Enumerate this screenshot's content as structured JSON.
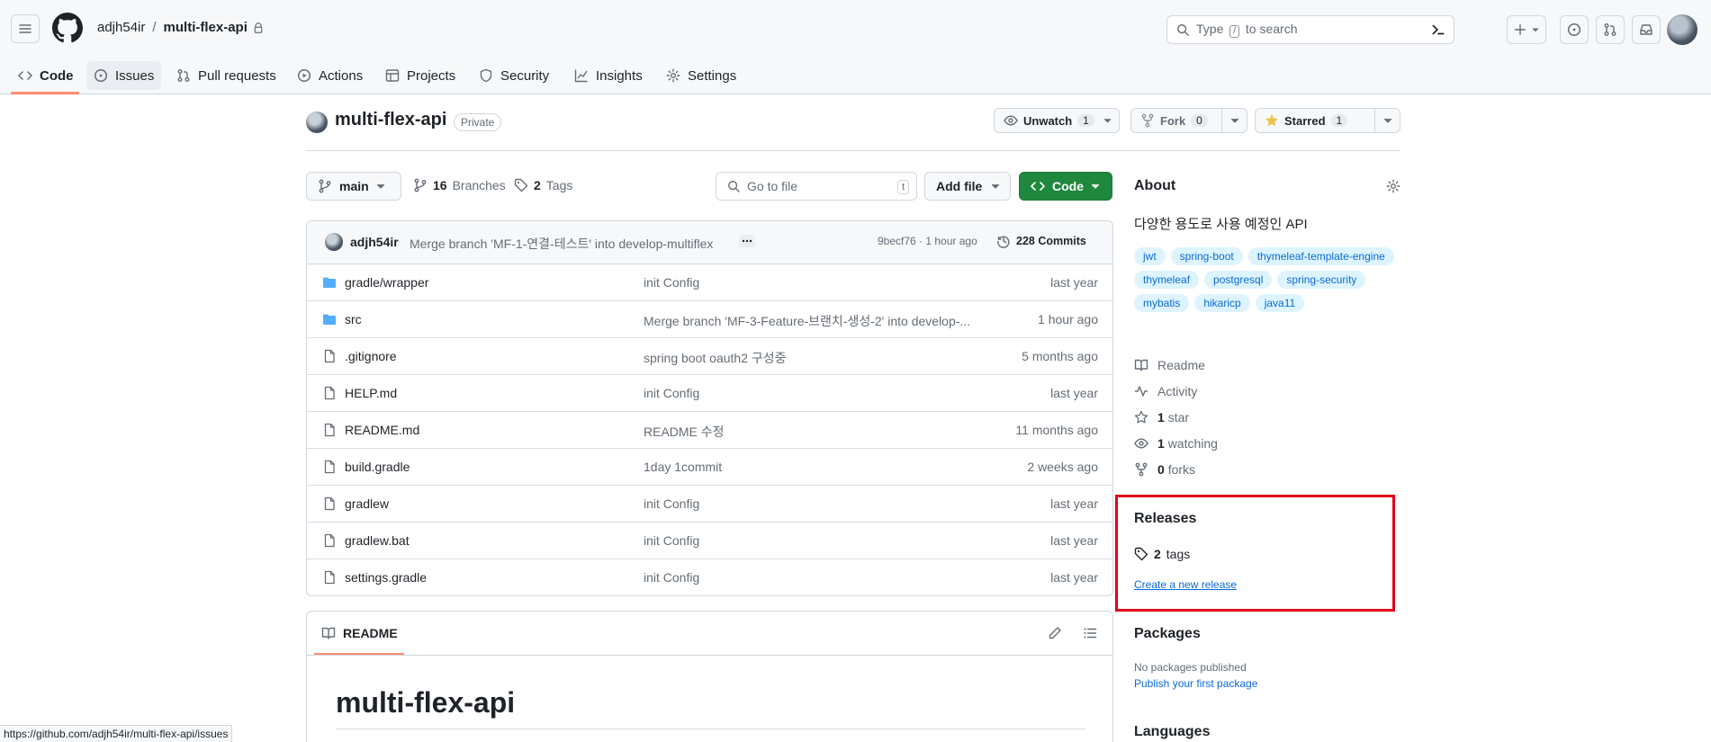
{
  "header": {
    "owner": "adjh54ir",
    "separator": "/",
    "repo": "multi-flex-api",
    "search_prefix": "Type",
    "search_key": "/",
    "search_suffix": "to search"
  },
  "tabs": [
    {
      "label": "Code"
    },
    {
      "label": "Issues"
    },
    {
      "label": "Pull requests"
    },
    {
      "label": "Actions"
    },
    {
      "label": "Projects"
    },
    {
      "label": "Security"
    },
    {
      "label": "Insights"
    },
    {
      "label": "Settings"
    }
  ],
  "repo": {
    "name": "multi-flex-api",
    "visibility": "Private",
    "watch_label": "Unwatch",
    "watch_count": "1",
    "fork_label": "Fork",
    "fork_count": "0",
    "star_label": "Starred",
    "star_count": "1"
  },
  "nav": {
    "branch": "main",
    "branches_count": "16",
    "branches_label": "Branches",
    "tags_count": "2",
    "tags_label": "Tags",
    "goto_placeholder": "Go to file",
    "goto_key": "t",
    "add_file": "Add file",
    "code": "Code"
  },
  "commit": {
    "author": "adjh54ir",
    "message": "Merge branch 'MF-1-연결-테스트' into develop-multiflex",
    "hash_time": "9becf76 · 1 hour ago",
    "count_label": "228 Commits"
  },
  "files": [
    {
      "name": "gradle/wrapper",
      "type": "dir",
      "message": "init Config",
      "time": "last year"
    },
    {
      "name": "src",
      "type": "dir",
      "message": "Merge branch 'MF-3-Feature-브랜치-생성-2' into develop-...",
      "time": "1 hour ago"
    },
    {
      "name": ".gitignore",
      "type": "file",
      "message": "spring boot oauth2 구성중",
      "time": "5 months ago"
    },
    {
      "name": "HELP.md",
      "type": "file",
      "message": "init Config",
      "time": "last year"
    },
    {
      "name": "README.md",
      "type": "file",
      "message": "README 수정",
      "time": "11 months ago"
    },
    {
      "name": "build.gradle",
      "type": "file",
      "message": "1day 1commit",
      "time": "2 weeks ago"
    },
    {
      "name": "gradlew",
      "type": "file",
      "message": "init Config",
      "time": "last year"
    },
    {
      "name": "gradlew.bat",
      "type": "file",
      "message": "init Config",
      "time": "last year"
    },
    {
      "name": "settings.gradle",
      "type": "file",
      "message": "init Config",
      "time": "last year"
    }
  ],
  "readme": {
    "tab_label": "README",
    "title": "multi-flex-api"
  },
  "about": {
    "title": "About",
    "description": "다양한 용도로 사용 예정인 API",
    "topics": [
      "jwt",
      "spring-boot",
      "thymeleaf-template-engine",
      "thymeleaf",
      "postgresql",
      "spring-security",
      "mybatis",
      "hikaricp",
      "java11"
    ],
    "readme": "Readme",
    "activity": "Activity",
    "stars_count": "1",
    "stars_label": "star",
    "watching_count": "1",
    "watching_label": "watching",
    "forks_count": "0",
    "forks_label": "forks"
  },
  "releases": {
    "title": "Releases",
    "tags_count": "2",
    "tags_label": "tags",
    "create_link": "Create a new release"
  },
  "packages": {
    "title": "Packages",
    "none": "No packages published",
    "publish_link": "Publish your first package"
  },
  "languages": {
    "title": "Languages"
  },
  "status_bar": {
    "url": "https://github.com/adjh54ir/multi-flex-api/issues"
  },
  "colors": {
    "accent_green": "#1f883d",
    "link_blue": "#0969da",
    "tab_underline": "#fd8c73",
    "highlight_box": "#e0001a",
    "star_yellow": "#eac54f",
    "folder_blue": "#54aeff"
  }
}
